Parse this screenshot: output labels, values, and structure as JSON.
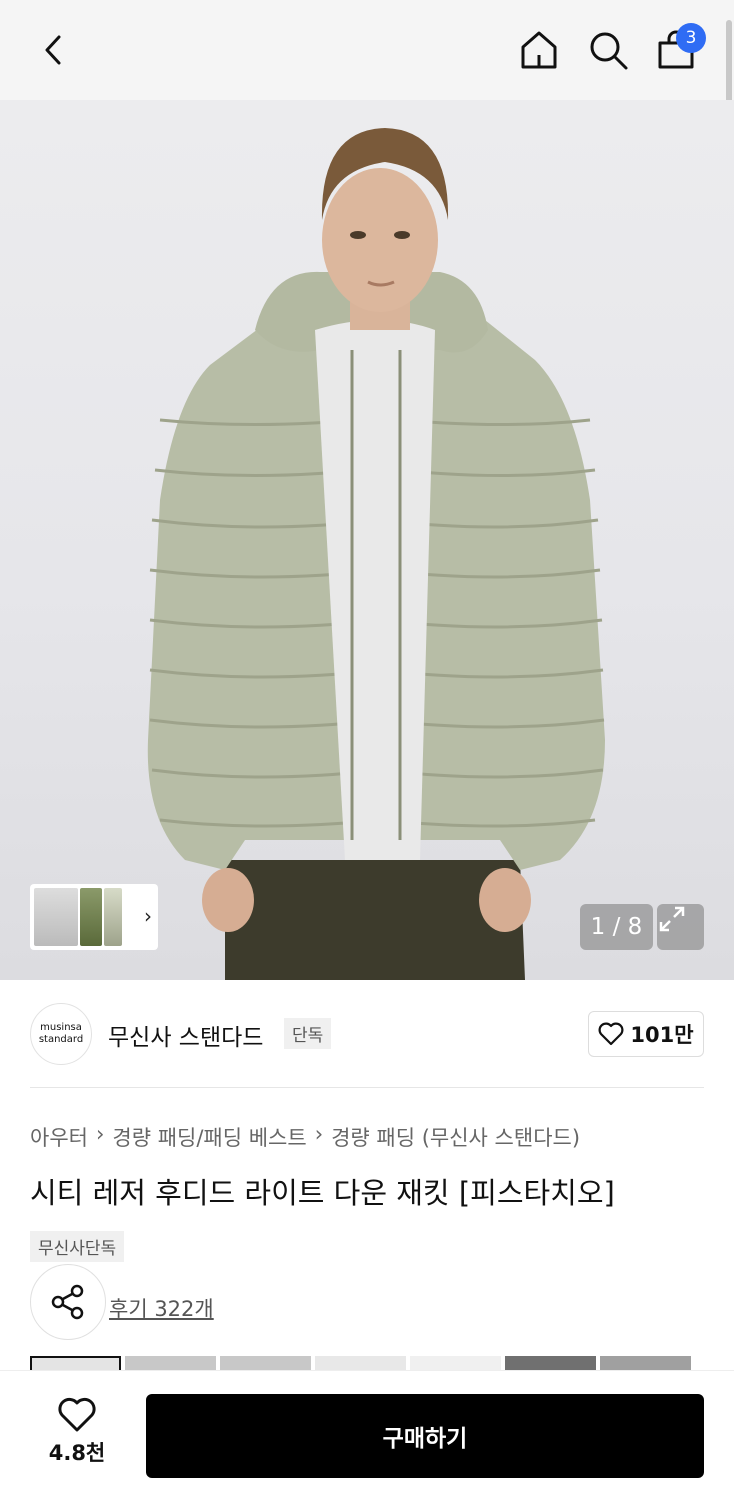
{
  "header": {
    "icons": [
      "chevron-left-icon",
      "home-icon",
      "search-icon",
      "shopping-bag-icon"
    ],
    "cart_count": "3"
  },
  "gallery": {
    "counter": "1 / 8",
    "icons": [
      "chevron-right-icon",
      "expand-icon"
    ]
  },
  "brand": {
    "logo_line1": "musinsa",
    "logo_line2": "standard",
    "name": "무신사 스탠다드",
    "tag": "단독",
    "like_count": "101만"
  },
  "product": {
    "breadcrumb": [
      "아우터",
      "경량 패딩/패딩 베스트",
      "경량 패딩 (무신사 스탠다드)"
    ],
    "title": "시티 레저 후디드 라이트 다운 재킷 [피스타치오]",
    "exclusive_tag": "무신사단독",
    "reviews": "후기 322개"
  },
  "bottom_bar": {
    "wish_count": "4.8천",
    "buy_label": "구매하기"
  },
  "colors": {
    "accent": "#2f6cf4",
    "buy_button": "#000000"
  }
}
